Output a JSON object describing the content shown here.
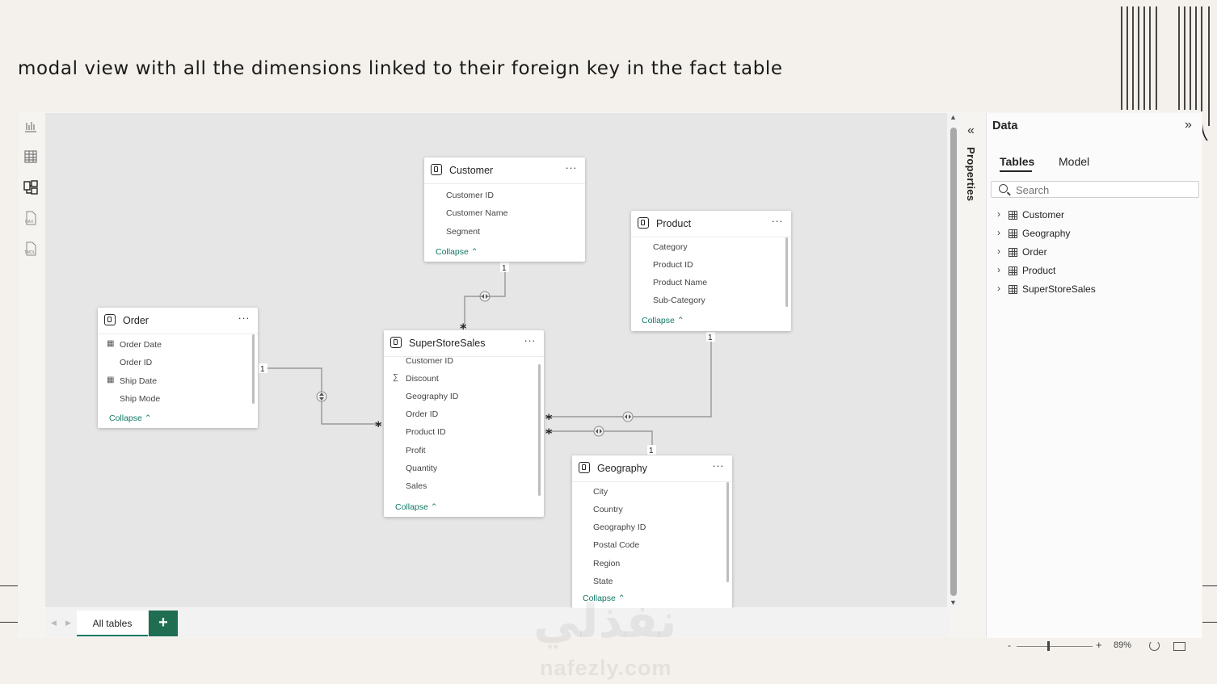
{
  "slide": {
    "title": "modal view with all the dimensions linked to their foreign key in the fact table"
  },
  "left_rail": {
    "icons": [
      "report-view-icon",
      "table-view-icon",
      "model-view-icon",
      "dax-query-view-icon",
      "tmdl-view-icon"
    ],
    "active": "model-view-icon"
  },
  "tables": {
    "customer": {
      "name": "Customer",
      "fields": [
        "Customer ID",
        "Customer Name",
        "Segment"
      ],
      "collapse": "Collapse"
    },
    "product": {
      "name": "Product",
      "fields": [
        "Category",
        "Product ID",
        "Product Name",
        "Sub-Category"
      ],
      "collapse": "Collapse"
    },
    "order": {
      "name": "Order",
      "fields": [
        "Order Date",
        "Order ID",
        "Ship Date",
        "Ship Mode"
      ],
      "collapse": "Collapse"
    },
    "superstoresales": {
      "name": "SuperStoreSales",
      "fields": [
        "Customer ID",
        "Discount",
        "Geography ID",
        "Order ID",
        "Product ID",
        "Profit",
        "Quantity",
        "Sales"
      ],
      "collapse": "Collapse"
    },
    "geography": {
      "name": "Geography",
      "fields": [
        "City",
        "Country",
        "Geography ID",
        "Postal Code",
        "Region",
        "State"
      ],
      "collapse": "Collapse"
    },
    "more_label": "···"
  },
  "relationships": {
    "one": "1",
    "many": "*"
  },
  "bottom_bar": {
    "tab_label": "All tables",
    "add_label": "+"
  },
  "properties_pane": {
    "label": "Properties",
    "expand_glyph": "«"
  },
  "data_pane": {
    "title": "Data",
    "collapse_glyph": "»",
    "tabs": [
      "Tables",
      "Model"
    ],
    "search_placeholder": "Search",
    "items": [
      "Customer",
      "Geography",
      "Order",
      "Product",
      "SuperStoreSales"
    ]
  },
  "zoom": {
    "minus": "-",
    "plus": "+",
    "value": "89%"
  },
  "watermark": {
    "arabic": "نفذلي",
    "latin": "nafezly.com"
  },
  "colors": {
    "accent": "#117865",
    "add_button": "#1f6e52",
    "canvas": "#e6e6e6",
    "slide_background": "#f4f1ec"
  }
}
